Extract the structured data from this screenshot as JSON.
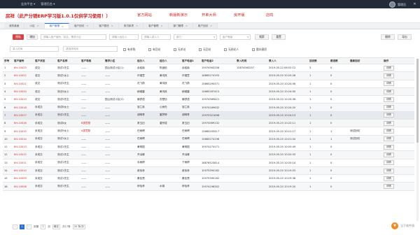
{
  "topbar": {
    "menu": [
      "业务平台 ▾",
      "管理后台 ▾"
    ],
    "user": "管理员",
    "close": "✕"
  },
  "banner": {
    "text": "房祥（此产分销ERP学习版1.0.1仅供学习使用！）",
    "links": [
      "官方网站",
      "新版新演示",
      "开单大师",
      "房开版",
      "店鸣"
    ]
  },
  "tabs": [
    {
      "label": "我的桌面"
    },
    {
      "label": "小区"
    },
    {
      "label": "客户管理",
      "active": true
    },
    {
      "label": "客户回访"
    },
    {
      "label": "客户跟进"
    },
    {
      "label": "收付款项"
    },
    {
      "label": "客户管理"
    },
    {
      "label": "部门管理"
    },
    {
      "label": "客户回访"
    }
  ],
  "search": {
    "btn_left": "隐私",
    "btn_mid": "增加",
    "f1": "请输入客户编号、姓名、需求小区",
    "f2": "请输入经办人",
    "f3": "请输入录入人",
    "f4": "部门",
    "f5": "客户等级",
    "btn_search": "搜索",
    "btn_reset": "重置",
    "btn_del": "删除",
    "btn_export": "导出"
  },
  "filters": {
    "f_addr": "录入时间",
    "f_date": "请选择时间",
    "checks": [
      "有求购",
      "有回访",
      "无求访",
      "无回访",
      "无经纪人",
      "晨向意愿"
    ]
  },
  "table": {
    "headers": [
      "序号",
      "客户编号",
      "客户状态",
      "客户名称",
      "客户等级",
      "需求小区",
      "经办人",
      "经办人",
      "客户电话1",
      "客户电话2",
      "录入时间",
      "录入人",
      "回访数",
      "跟进数",
      "最新回访",
      "操作"
    ],
    "rows": [
      [
        "1",
        "KH-10023",
        "成交",
        "测试1先生",
        "——",
        "园山测试小区(1)",
        "余稻南",
        "陈绪松",
        "余稻南",
        "15974563258",
        "15874563257",
        "2019-05-22 08:52:12",
        "3",
        "0",
        "",
        "详情"
      ],
      [
        "2",
        "KH-10022",
        "成交",
        "测试2女士",
        "——",
        "——",
        "许瑾萱",
        "黄鸿良",
        "许瑾萱",
        "16865274193",
        "",
        "2019-05-20 10:25:26",
        "1",
        "0",
        "",
        "详情"
      ],
      [
        "3",
        "KH-10021",
        "成交",
        "测试3先生",
        "——",
        "——",
        "花飞扬",
        "黄鸿良",
        "花飞扬",
        "15865290371",
        "",
        "2019-05-20 10:24:56",
        "1",
        "0",
        "",
        "详情"
      ],
      [
        "4",
        "KH-10020",
        "成交",
        "测试4女士",
        "——",
        "——",
        "柳烟晨",
        "黄鸿良",
        "柳烟晨",
        "15865287415",
        "",
        "2019-05-20 10:24:50",
        "1",
        "0",
        "",
        "详情"
      ],
      [
        "5",
        "KH-10019",
        "成交",
        "测试5先生",
        "——",
        "园山测试小区(2)",
        "薛舒语",
        "苏楚协",
        "薛舒语",
        "15974569821",
        "",
        "2019-05-20 10:24:36",
        "1",
        "0",
        "",
        "详情"
      ],
      [
        "6",
        "KH-10018",
        "未成交",
        "测试6女士",
        "——",
        "——",
        "邹兰英",
        "公雨先",
        "邹兰英",
        "15974169632",
        "",
        "2019-05-20 10:24:20",
        "1",
        "0",
        "",
        "详情"
      ],
      [
        "7",
        "KH-10017",
        "未成交",
        "测试1先生",
        "——",
        "——",
        "胡明青",
        "董梦婷",
        "胡明青",
        "15975321698",
        "",
        "2019-05-20 10:24:13",
        "1",
        "0",
        "",
        "详情"
      ],
      [
        "8",
        "KH-10016",
        "未成交",
        "测试8女",
        "B类意愿",
        "——",
        "常玉旧",
        "唐宗斌",
        "常玉旧",
        "15974569132",
        "",
        "2019-05-20 10:22:11",
        "1",
        "0",
        "",
        "详情"
      ],
      [
        "9",
        "KH-10015",
        "未成交",
        "测试9女士",
        "A类意愿",
        "——",
        "任雨晴",
        "",
        "任雨晴",
        "15865293417",
        "",
        "2019-05-20 10:21:17",
        "1",
        "1",
        "测试回访",
        "详情"
      ],
      [
        "10",
        "KH-10014",
        "未成交",
        "测试1女士",
        "——",
        "——",
        "任雨晴",
        "",
        "任雨晴",
        "15865274196",
        "",
        "2019-05-20 10:21:04",
        "1",
        "1",
        "测试回访",
        "详情"
      ],
      [
        "11",
        "KH-10013",
        "未成交",
        "测试1先生",
        "——",
        "——",
        "黄明国",
        "",
        "黄明国",
        "15974174171",
        "",
        "2019-05-20 10:20:49",
        "1",
        "0",
        "",
        "详情"
      ],
      [
        "12",
        "KH-10012",
        "未成交",
        "测试2先生",
        "——",
        "——",
        "齐远峰",
        "",
        "齐远峰",
        "",
        "",
        "2019-05-20 10:20:33",
        "1",
        "0",
        "",
        "详情"
      ],
      [
        "13",
        "KH-10011",
        "未成交",
        "测试1先生",
        "——",
        "——",
        "韦雨婷",
        "",
        "下雨婷",
        "16876523814",
        "",
        "2019-05-20 10:20:14",
        "1",
        "0",
        "",
        "详情"
      ],
      [
        "14",
        "KH-10010",
        "未成交",
        "测试1先生",
        "——",
        "——",
        "政伟林",
        "",
        "政伟林",
        "15975390182",
        "",
        "2019-05-20 10:19:53",
        "1",
        "0",
        "",
        "详情"
      ],
      [
        "15",
        "KH-10009",
        "未成交",
        "测试1先生",
        "——",
        "——",
        "秦佳慧",
        "",
        "秦佳慧",
        "15975390182",
        "",
        "2019-05-20 10:19:38",
        "1",
        "0",
        "",
        "详情"
      ],
      [
        "16",
        "KH-10008",
        "未成交",
        "测试1先生",
        "——",
        "——",
        "林怡林",
        "水镇",
        "林怡林",
        "15974196302",
        "",
        "2019-05-20 10:19:20",
        "1",
        "0",
        "",
        "详情"
      ]
    ]
  },
  "pager": {
    "prev": "‹",
    "cur": "1",
    "next": "›",
    "goto_label": "到第",
    "goto_val": "1",
    "page_word": "页",
    "confirm": "确定",
    "total": "共17条",
    "size": "20 条/页"
  },
  "watermark": "当下软件园"
}
